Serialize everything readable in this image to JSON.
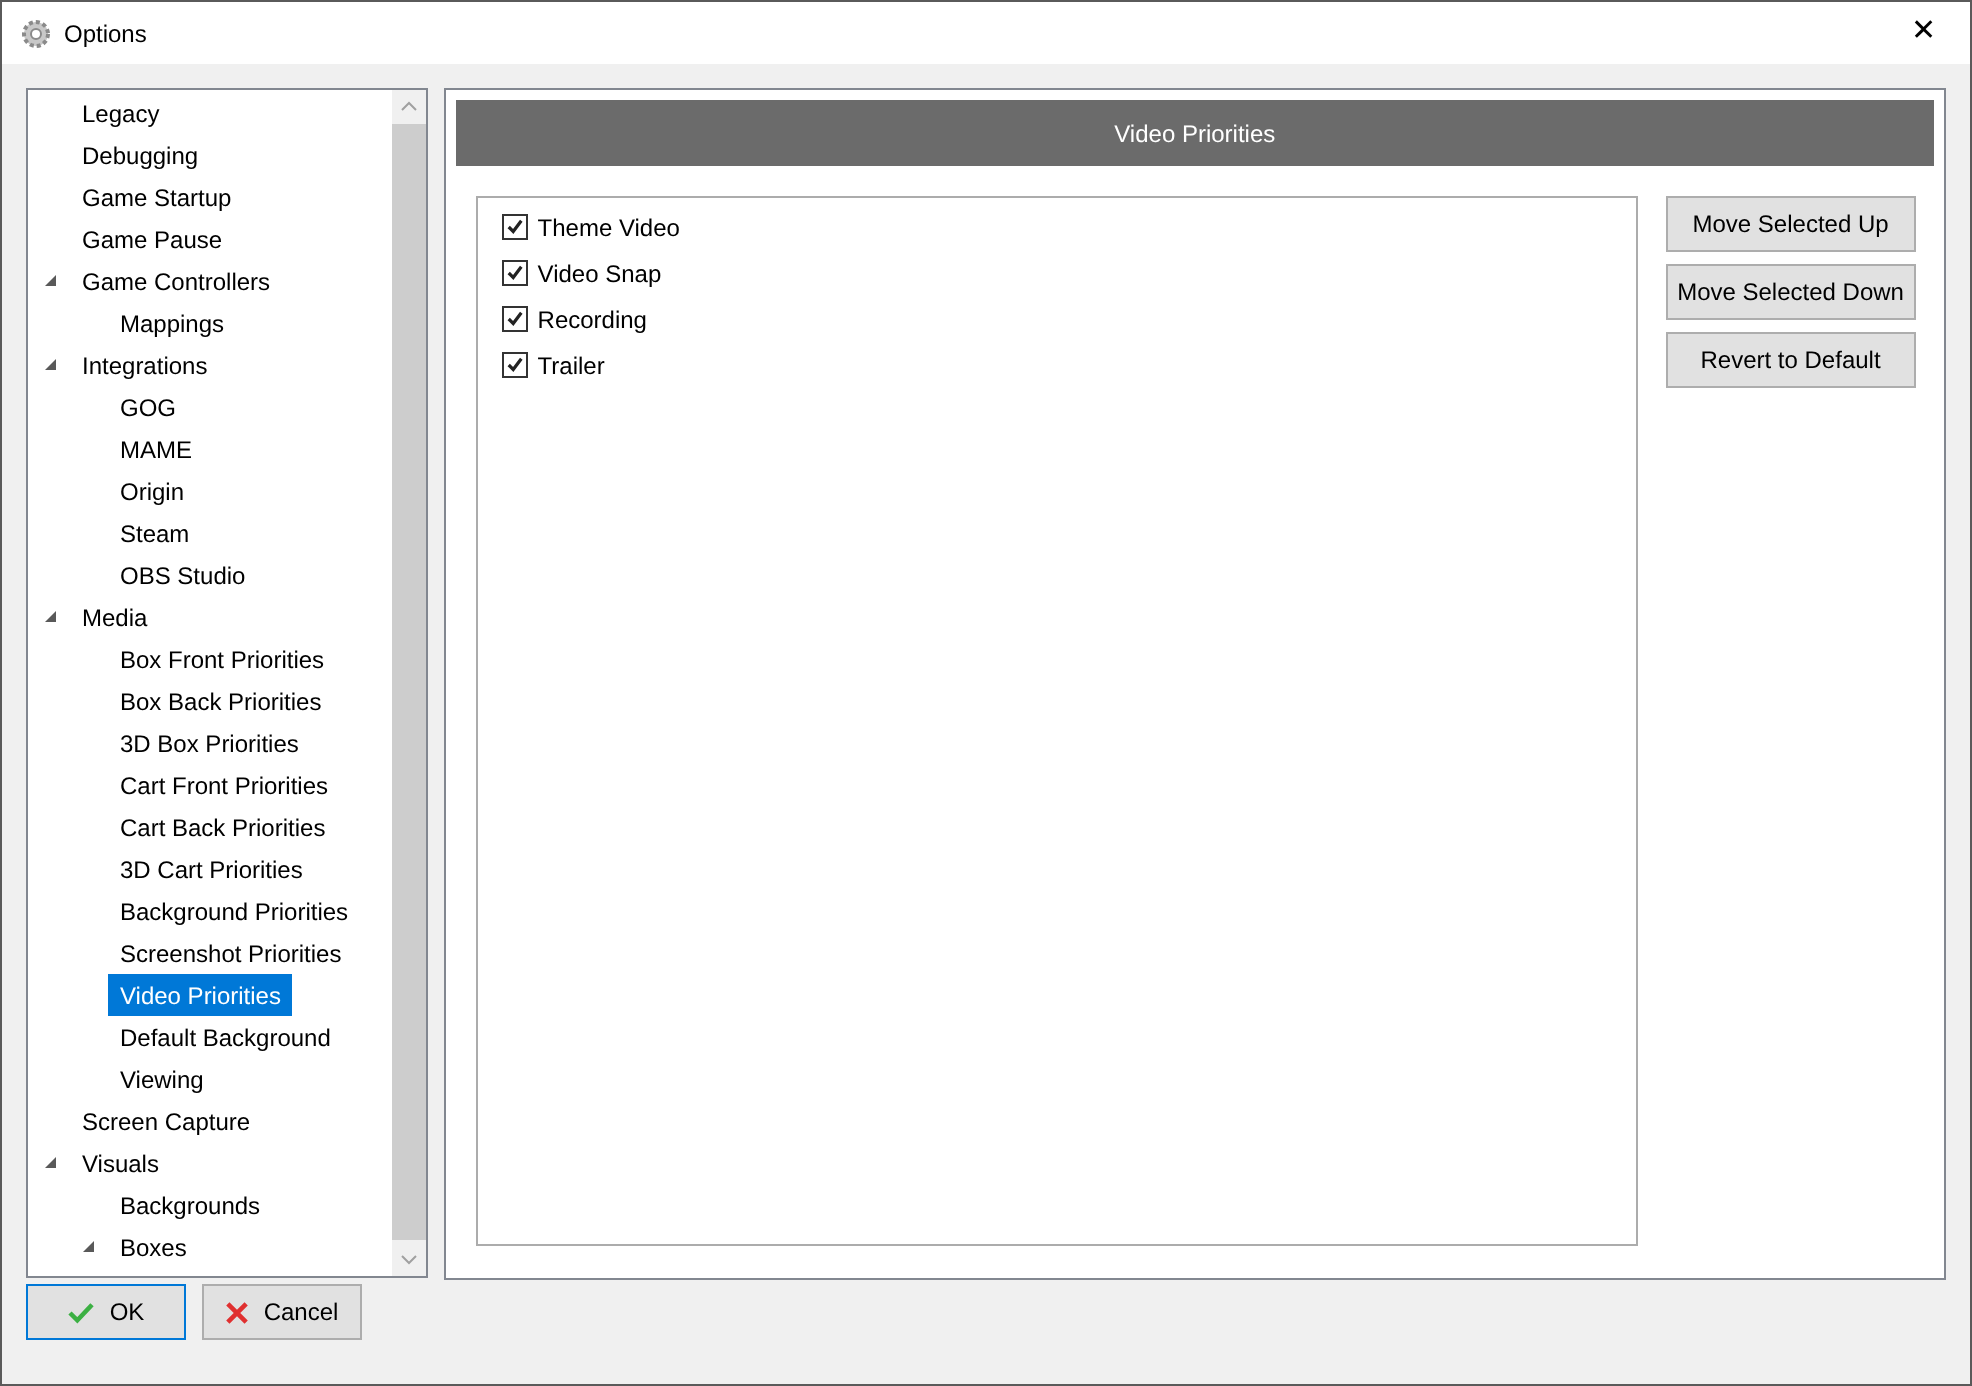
{
  "window": {
    "title": "Options",
    "close": "✕"
  },
  "tree": [
    {
      "label": "Legacy",
      "selected": false
    },
    {
      "label": "Debugging",
      "selected": false
    },
    {
      "label": "Game Startup",
      "selected": false
    },
    {
      "label": "Game Pause",
      "selected": false
    },
    {
      "label": "Game Controllers",
      "selected": false,
      "expanded": true,
      "children": [
        {
          "label": "Mappings",
          "selected": false
        }
      ]
    },
    {
      "label": "Integrations",
      "selected": false,
      "expanded": true,
      "children": [
        {
          "label": "GOG",
          "selected": false
        },
        {
          "label": "MAME",
          "selected": false
        },
        {
          "label": "Origin",
          "selected": false
        },
        {
          "label": "Steam",
          "selected": false
        },
        {
          "label": "OBS Studio",
          "selected": false
        }
      ]
    },
    {
      "label": "Media",
      "selected": false,
      "expanded": true,
      "children": [
        {
          "label": "Box Front Priorities",
          "selected": false
        },
        {
          "label": "Box Back Priorities",
          "selected": false
        },
        {
          "label": "3D Box Priorities",
          "selected": false
        },
        {
          "label": "Cart Front Priorities",
          "selected": false
        },
        {
          "label": "Cart Back Priorities",
          "selected": false
        },
        {
          "label": "3D Cart Priorities",
          "selected": false
        },
        {
          "label": "Background Priorities",
          "selected": false
        },
        {
          "label": "Screenshot Priorities",
          "selected": false
        },
        {
          "label": "Video Priorities",
          "selected": true
        },
        {
          "label": "Default Background",
          "selected": false
        },
        {
          "label": "Viewing",
          "selected": false
        }
      ]
    },
    {
      "label": "Screen Capture",
      "selected": false
    },
    {
      "label": "Visuals",
      "selected": false,
      "expanded": true,
      "children": [
        {
          "label": "Backgrounds",
          "selected": false
        },
        {
          "label": "Boxes",
          "selected": false,
          "expanded": true
        }
      ]
    }
  ],
  "panel": {
    "header": "Video Priorities",
    "items": [
      {
        "label": "Theme Video",
        "checked": true
      },
      {
        "label": "Video Snap",
        "checked": true
      },
      {
        "label": "Recording",
        "checked": true
      },
      {
        "label": "Trailer",
        "checked": true
      }
    ],
    "buttons": [
      "Move Selected Up",
      "Move Selected Down",
      "Revert to Default"
    ]
  },
  "footer": [
    {
      "label": "OK",
      "kind": "ok"
    },
    {
      "label": "Cancel",
      "kind": "cancel"
    }
  ]
}
